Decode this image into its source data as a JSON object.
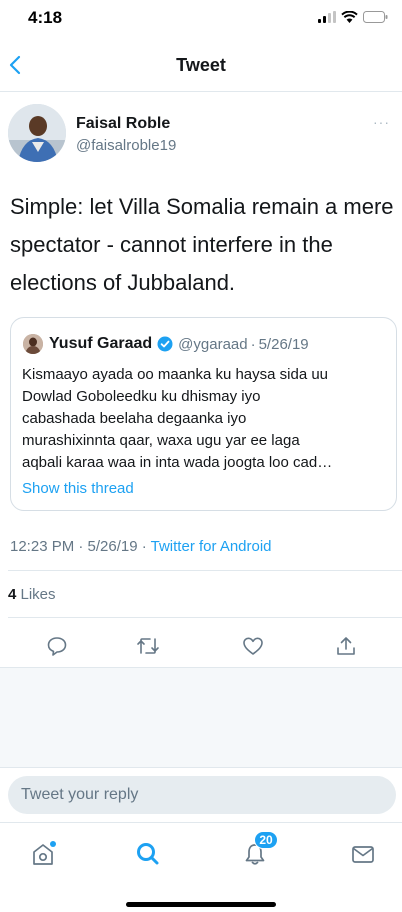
{
  "status_bar": {
    "time": "4:18"
  },
  "nav": {
    "title": "Tweet"
  },
  "tweet": {
    "author_name": "Faisal Roble",
    "author_handle": "@faisalroble19",
    "more_label": "···",
    "text": "Simple: let Villa Somalia remain a mere spectator - cannot interfere in the elections of Jubbaland.",
    "timestamp": "12:23 PM · 5/26/19 · ",
    "source": "Twitter for Android",
    "likes_count": "4",
    "likes_label": " Likes"
  },
  "quoted_tweet": {
    "name": "Yusuf Garaad",
    "handle": "@ygaraad",
    "separator": "·",
    "date": "5/26/19",
    "text": "Kismaayo ayada oo maanka ku haysa sida uu\nDowlad Goboleedku ku dhismay iyo\ncabashada beelaha degaanka iyo\nmurashixinnta qaar, waxa ugu yar ee laga\naqbali karaa waa in inta wada joogta loo cad…",
    "link": "Show this thread"
  },
  "reply": {
    "placeholder": "Tweet your reply"
  },
  "tab_bar": {
    "notifications_badge": "20"
  },
  "colors": {
    "accent": "#1da1f2",
    "secondary_text": "#657786",
    "border": "#e1e8ed"
  }
}
